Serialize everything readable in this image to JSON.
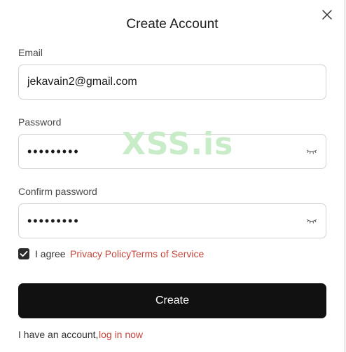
{
  "dialog": {
    "title": "Create Account",
    "close_icon": "close-icon"
  },
  "email": {
    "label": "Email",
    "value": "jekavain2@gmail.com"
  },
  "password": {
    "label": "Password",
    "masked_value": "•••••••••",
    "toggle_icon": "eye-closed-icon"
  },
  "confirm_password": {
    "label": "Confirm password",
    "masked_value": "•••••••••",
    "toggle_icon": "eye-closed-icon"
  },
  "agreement": {
    "checked": true,
    "prefix": "I agree",
    "privacy_link": "Privacy Policy",
    "terms_link": "Terms of Service"
  },
  "submit": {
    "label": "Create"
  },
  "footer": {
    "text": "I have an account,",
    "login_link": "log in now"
  },
  "watermark": {
    "text": "XSS.is"
  },
  "colors": {
    "link": "#c6453d",
    "button_bg": "#111111",
    "watermark": "#c8ebc8"
  }
}
